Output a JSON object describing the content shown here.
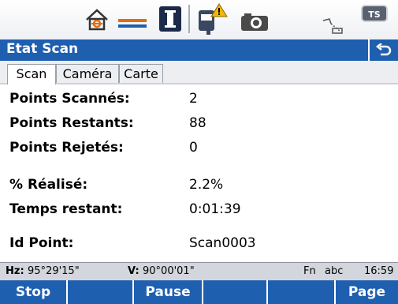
{
  "title": "Etat Scan",
  "tabs": [
    {
      "label": "Scan",
      "active": true
    },
    {
      "label": "Caméra",
      "active": false
    },
    {
      "label": "Carte",
      "active": false
    }
  ],
  "fields": [
    {
      "label": "Points Scannés:",
      "value": "2"
    },
    {
      "label": "Points Restants:",
      "value": "88"
    },
    {
      "label": "Points Rejetés:",
      "value": "0"
    },
    {
      "label": "% Réalisé:",
      "value": "2.2%"
    },
    {
      "label": "Temps restant:",
      "value": "0:01:39"
    },
    {
      "label": "Id Point:",
      "value": "Scan0003"
    }
  ],
  "status": {
    "hz_label": "Hz:",
    "hz_value": "95°29'15\"",
    "v_label": "V:",
    "v_value": "90°00'01\"",
    "fn": "Fn",
    "abc": "abc",
    "time": "16:59"
  },
  "softkeys": [
    "Stop",
    "",
    "Pause",
    "",
    "",
    "Page"
  ],
  "topbar": {
    "icons": [
      "home-target-icon",
      "prism-icon",
      "instrument-icon",
      "battery-warning-icon",
      "camera-icon",
      "laser-pointer-icon",
      "ts-badge-icon"
    ],
    "ts_badge": "TS"
  },
  "colors": {
    "accent": "#1f5fb0",
    "status_bg": "#d3d6dc",
    "warning": "#f2b705"
  }
}
